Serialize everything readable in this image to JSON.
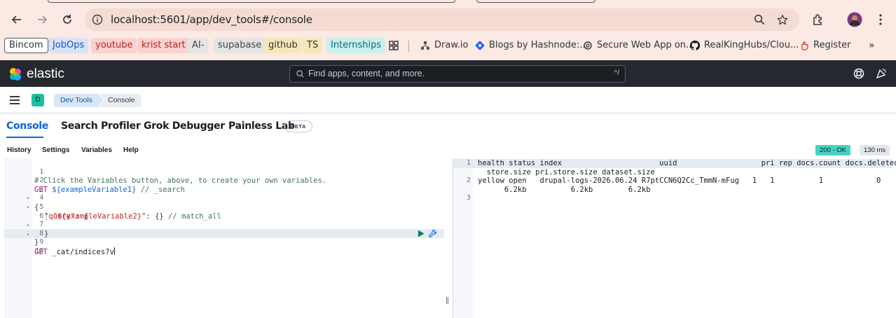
{
  "browser": {
    "url": "localhost:5601/app/dev_tools#/console",
    "bookmarks": [
      {
        "label": "Bincom",
        "bg": "#ffffff",
        "color": "#333333",
        "border": "#555555"
      },
      {
        "label": "JobOps",
        "bg": "#d8e2f8",
        "color": "#1a56b8"
      },
      {
        "label": "youtube",
        "bg": "#f9d2d0",
        "color": "#b3261e"
      },
      {
        "label": "krist start",
        "bg": "#f9d2d0",
        "color": "#b3261e"
      },
      {
        "label": "AI-",
        "bg": "#e4e4e4",
        "color": "#444444"
      },
      {
        "label": "supabase",
        "bg": "#e4e4e4",
        "color": "#444444"
      },
      {
        "label": "github",
        "bg": "#f5e7b8",
        "color": "#333333"
      },
      {
        "label": "TS",
        "bg": "#f5e7b8",
        "color": "#333333"
      },
      {
        "label": "Internships",
        "bg": "#c9efee",
        "color": "#0d6e6e"
      }
    ],
    "bookmark_links": [
      {
        "label": "Draw.io",
        "icon": "drawio-icon"
      },
      {
        "label": "Blogs by Hashnode:...",
        "icon": "hashnode-icon"
      },
      {
        "label": "Secure Web App on...",
        "icon": "openai-icon"
      },
      {
        "label": "RealKingHubs/Clou...",
        "icon": "github-icon"
      },
      {
        "label": "Register",
        "icon": "hand-icon"
      }
    ]
  },
  "kibana": {
    "logo_text": "elastic",
    "search_placeholder": "Find apps, content, and more.",
    "search_shortcut": "^/",
    "space_initial": "D",
    "breadcrumbs": [
      "Dev Tools",
      "Console"
    ]
  },
  "tabs": [
    {
      "label": "Console",
      "active": true
    },
    {
      "label": "Search Profiler",
      "active": false
    },
    {
      "label": "Grok Debugger",
      "active": false
    },
    {
      "label": "Painless Lab",
      "active": false
    }
  ],
  "beta_label": "BETA",
  "console_menu": [
    "History",
    "Settings",
    "Variables",
    "Help"
  ],
  "response_status": {
    "code": "200 - OK",
    "time": "130 ms"
  },
  "request_lines": [
    {
      "n": "1",
      "fold": ""
    },
    {
      "n": "2",
      "fold": ""
    },
    {
      "n": "3",
      "fold": "▾"
    },
    {
      "n": "4",
      "fold": "▾"
    },
    {
      "n": "5",
      "fold": ""
    },
    {
      "n": "6",
      "fold": "▴"
    },
    {
      "n": "7",
      "fold": "▴"
    },
    {
      "n": "8",
      "fold": ""
    },
    {
      "n": "9",
      "fold": ""
    },
    {
      "n": "10",
      "fold": ""
    }
  ],
  "request": {
    "l1": "# Click the Variables button, above, to create your own variables.",
    "l2_method": "GET",
    "l2_path": " ${exampleVariable1}",
    "l2_comment": " // _search",
    "l3": "{",
    "l4_key": "\"query\"",
    "l4_rest": ": {",
    "l5_bar": "│ ",
    "l5_key": "\"${exampleVariable2}\"",
    "l5_rest": ": {}",
    "l5_comment": " // match_all",
    "l6": "}",
    "l7": "}",
    "l9_method": "GET",
    "l9_path": " _cat/indices?v"
  },
  "response_lines": [
    {
      "n": "1",
      "text": "health status index                      uuid                   pri rep docs.count docs.deleted"
    },
    {
      "n": "",
      "text": "  store.size pri.store.size dataset.size"
    },
    {
      "n": "2",
      "text": "yellow open   drupal-logs-2026.06.24 R7ptCCN6Q2Cc_TmmN-mFug   1   1          1            0"
    },
    {
      "n": "",
      "text": "      6.2kb          6.2kb        6.2kb"
    },
    {
      "n": "3",
      "text": ""
    }
  ]
}
